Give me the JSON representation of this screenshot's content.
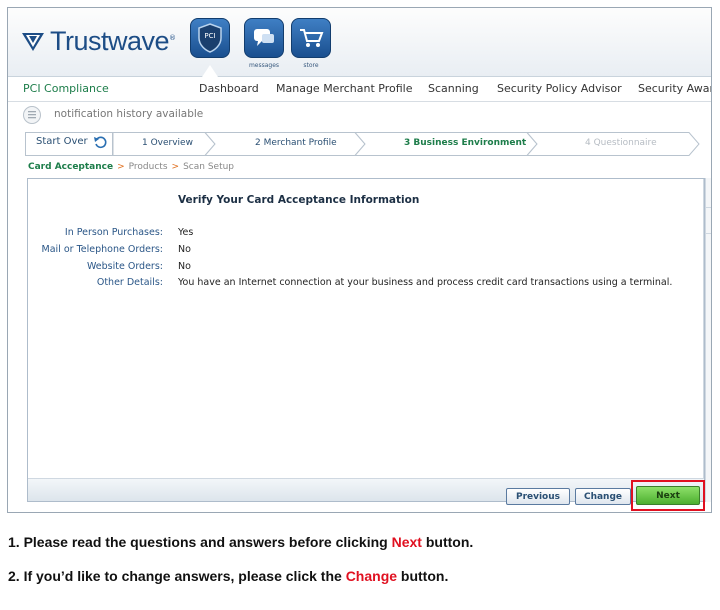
{
  "brand": {
    "name": "Trustwave",
    "trademark": "®"
  },
  "header": {
    "buttons": [
      {
        "id": "pci",
        "label": "PCI",
        "caption": ""
      },
      {
        "id": "messages",
        "label": "",
        "caption": "messages"
      },
      {
        "id": "store",
        "label": "",
        "caption": "store"
      }
    ]
  },
  "nav": {
    "title": "PCI Compliance",
    "items": [
      "Dashboard",
      "Manage Merchant Profile",
      "Scanning",
      "Security Policy Advisor",
      "Security Awar"
    ]
  },
  "notification": {
    "text": "notification history available"
  },
  "wizard": {
    "start_over": "Start Over",
    "steps": [
      {
        "label": "1 Overview",
        "state": "done"
      },
      {
        "label": "2 Merchant Profile",
        "state": "done"
      },
      {
        "label": "3 Business Environment",
        "state": "active"
      },
      {
        "label": "4 Questionnaire",
        "state": "disabled"
      }
    ]
  },
  "breadcrumb": [
    "Card Acceptance",
    "Products",
    "Scan Setup"
  ],
  "panel": {
    "title": "Verify Your Card Acceptance Information",
    "rows": [
      {
        "label": "In Person Purchases:",
        "value": "Yes"
      },
      {
        "label": "Mail or Telephone Orders:",
        "value": "No"
      },
      {
        "label": "Website Orders:",
        "value": "No"
      },
      {
        "label": "Other Details:",
        "value": "You have an Internet connection at your business and process credit card transactions using a terminal."
      }
    ]
  },
  "buttons": {
    "previous": "Previous",
    "change": "Change",
    "next": "Next"
  },
  "instructions": {
    "line1": {
      "pre": "1. Please read the questions and answers before clicking ",
      "highlight": "Next",
      "post": " button."
    },
    "line2": {
      "pre": "2. If you’d like to change answers, please click the ",
      "highlight": "Change",
      "post": " button."
    }
  },
  "colors": {
    "brand_blue": "#1d4d86",
    "accent_green": "#1d7d4a",
    "highlight_red": "#e01020"
  }
}
